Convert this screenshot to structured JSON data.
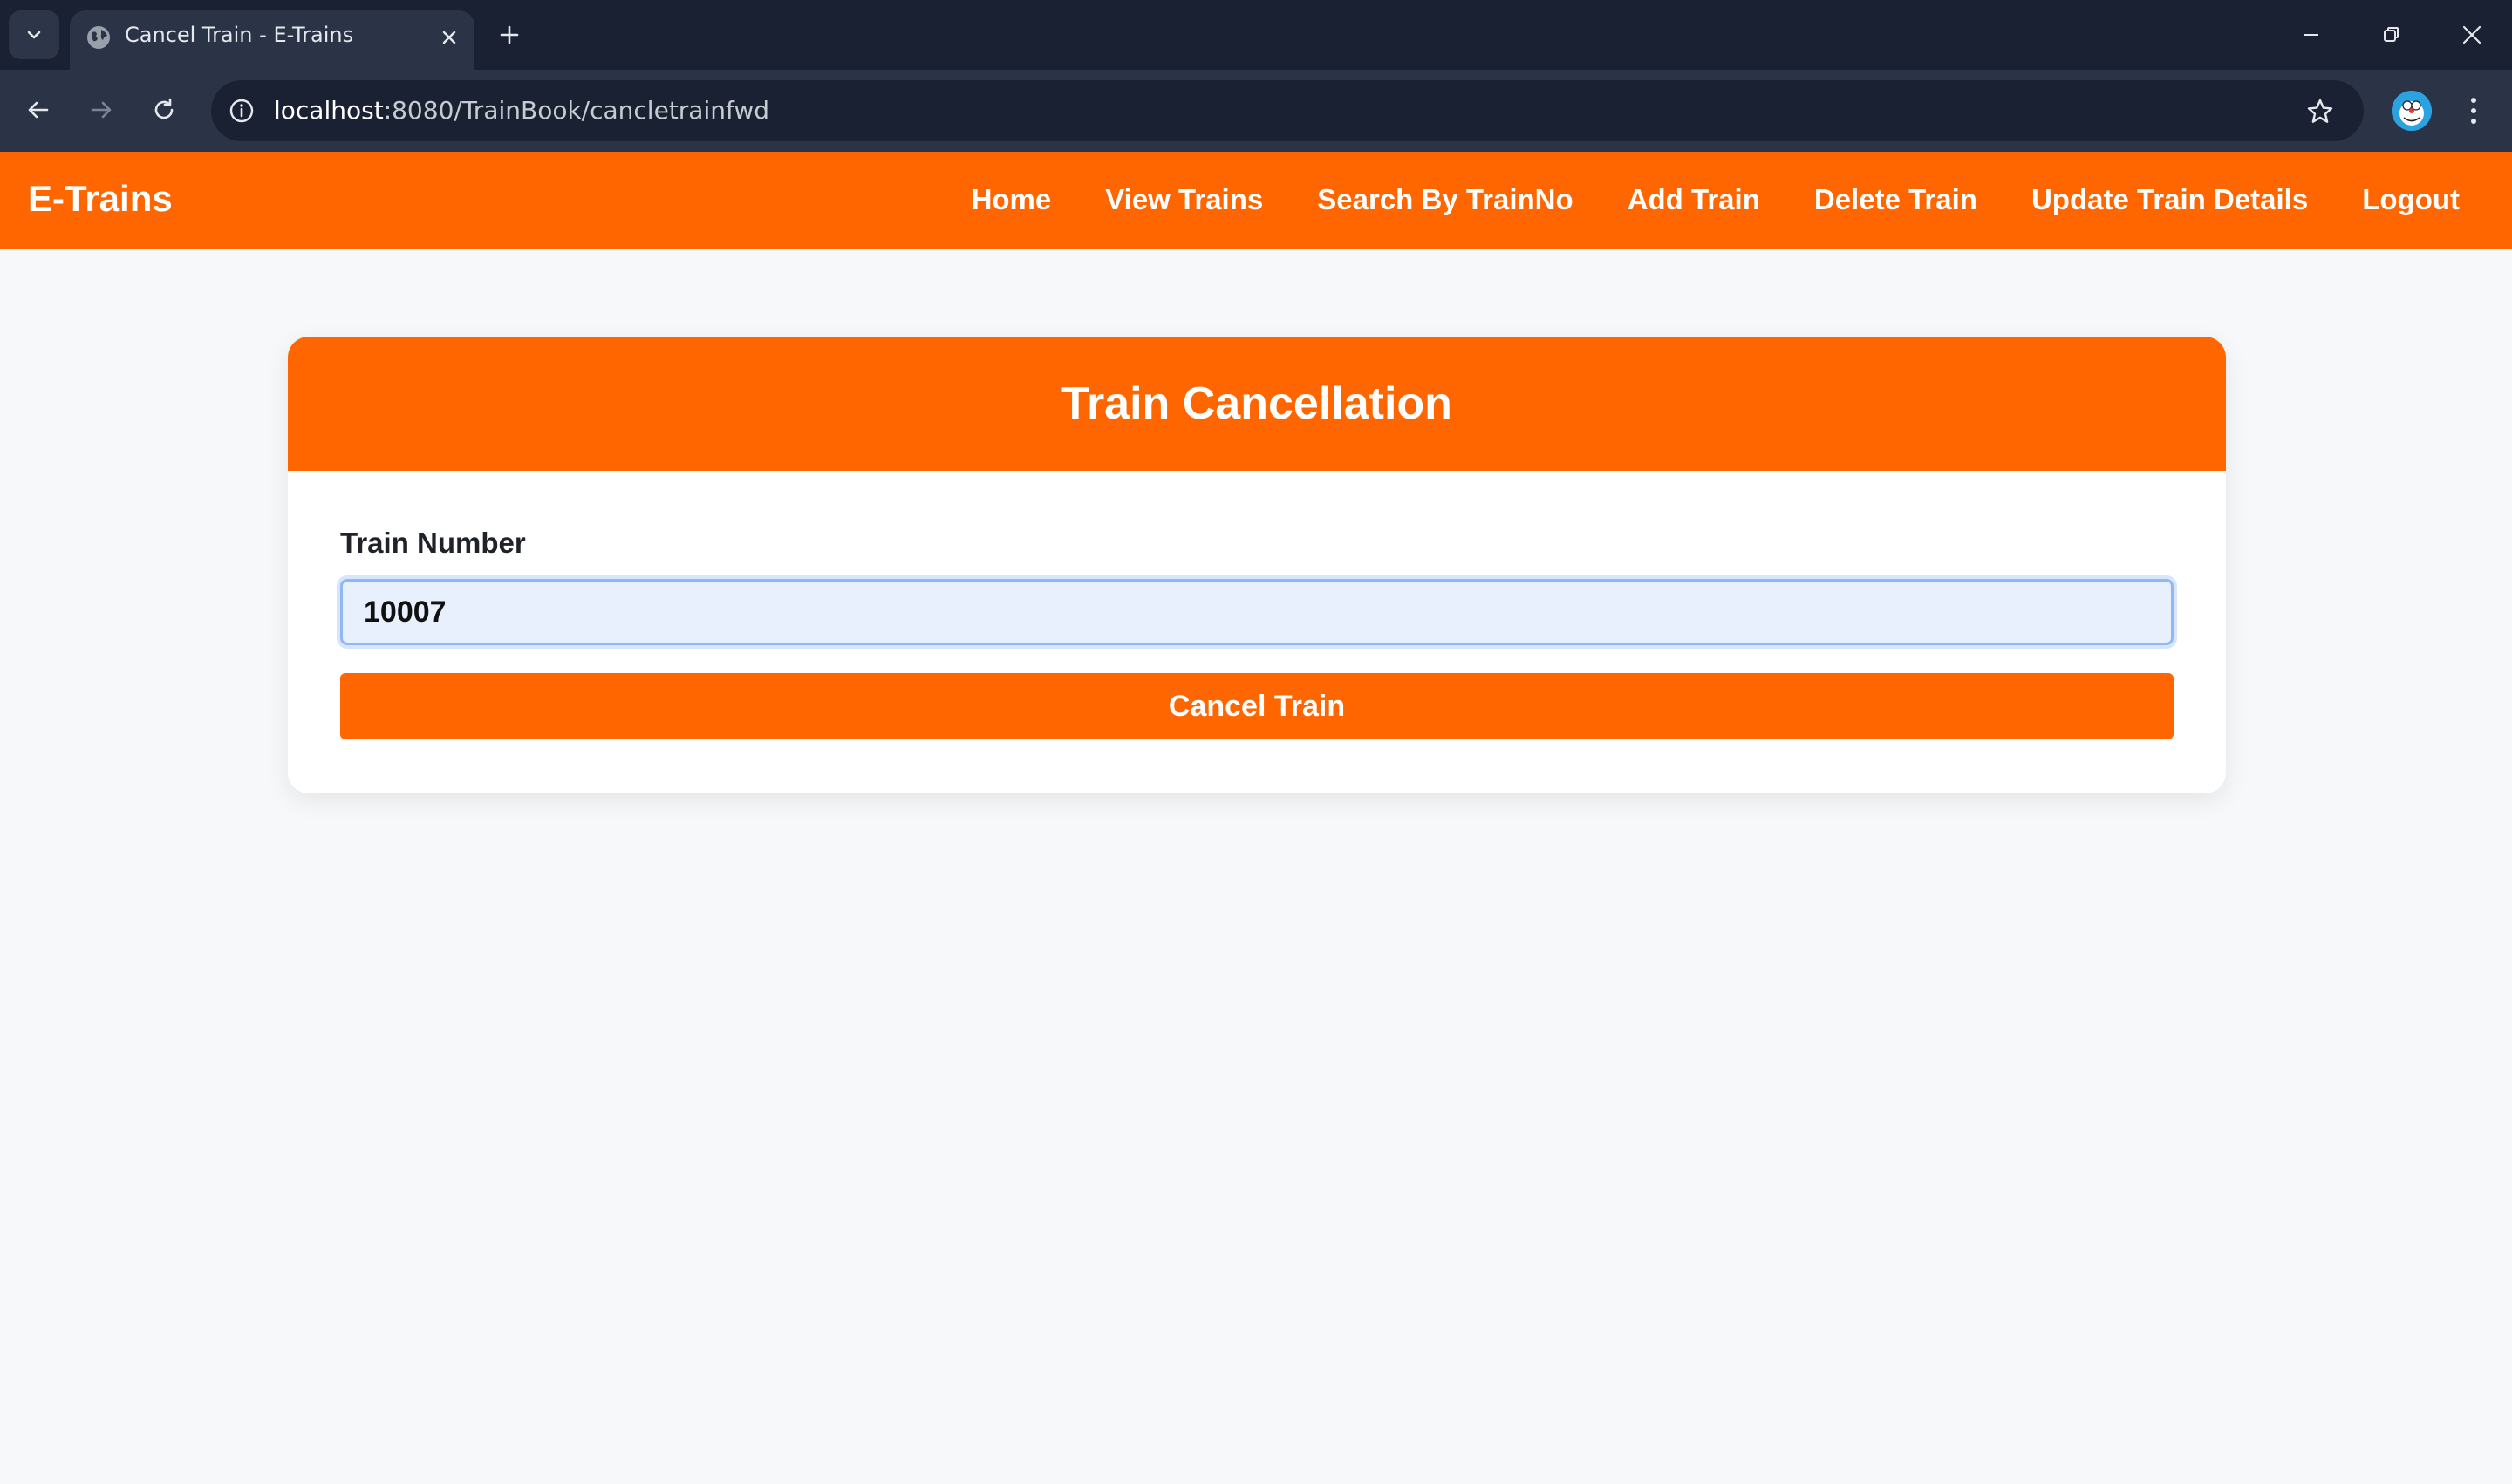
{
  "browser": {
    "tab_title": "Cancel Train - E-Trains",
    "url_host": "localhost",
    "url_rest": ":8080/TrainBook/cancletrainfwd"
  },
  "site": {
    "brand": "E-Trains",
    "nav": [
      {
        "label": "Home"
      },
      {
        "label": "View Trains"
      },
      {
        "label": "Search By TrainNo"
      },
      {
        "label": "Add Train"
      },
      {
        "label": "Delete Train"
      },
      {
        "label": "Update Train Details"
      },
      {
        "label": "Logout"
      }
    ],
    "accent_color": "#ff6600"
  },
  "form": {
    "title": "Train Cancellation",
    "label": "Train Number",
    "value": "10007",
    "submit_label": "Cancel Train"
  }
}
